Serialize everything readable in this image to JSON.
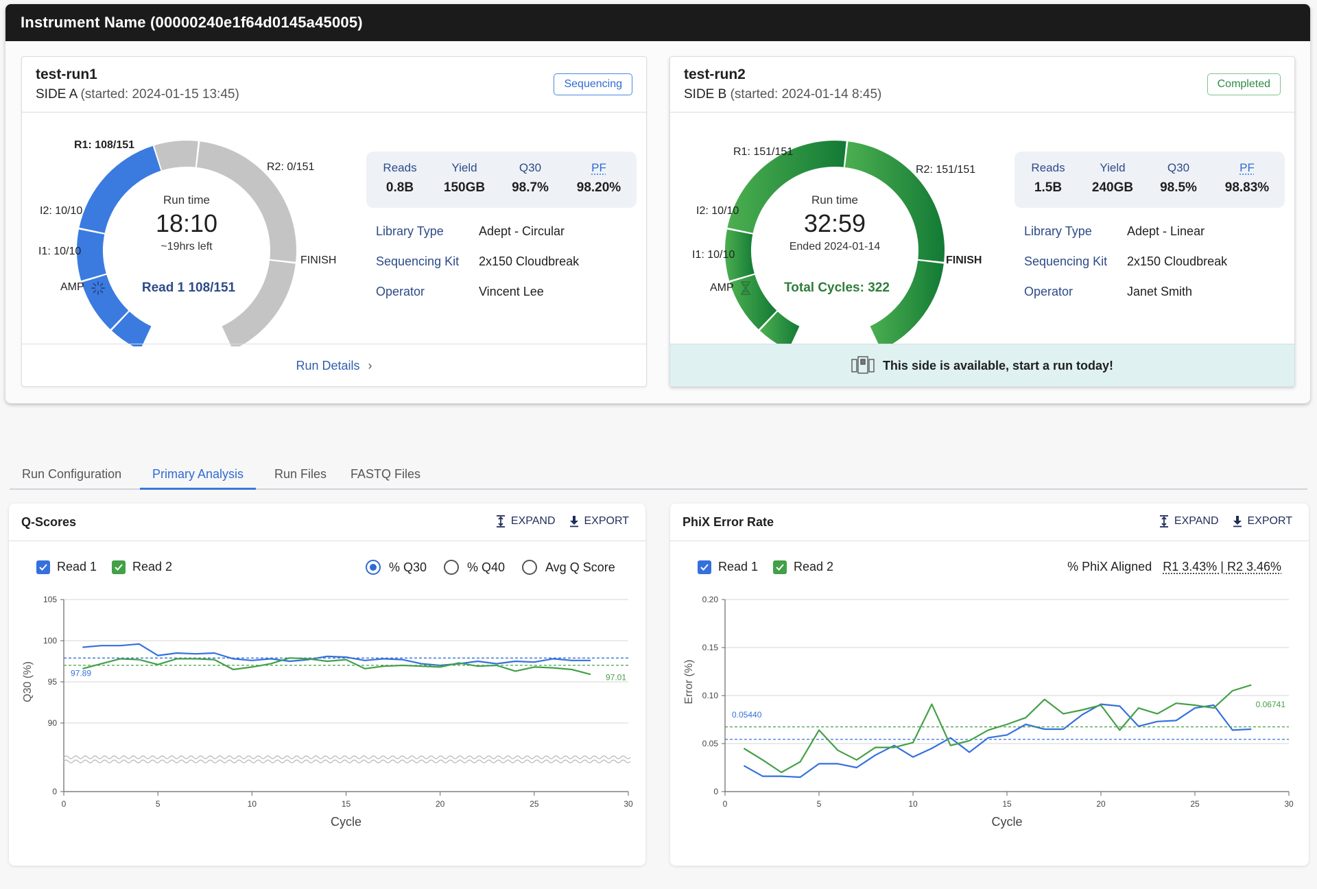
{
  "instrument": {
    "title": "Instrument Name (00000240e1f64d0145a45005)"
  },
  "runs": [
    {
      "name": "test-run1",
      "side": "SIDE A",
      "started": "(started: 2024-01-15 13:45)",
      "status": "Sequencing",
      "gauge": {
        "segments": [
          {
            "key": "AMP",
            "label": "AMP",
            "complete": true
          },
          {
            "key": "I1",
            "label": "I1: 10/10",
            "done": 10,
            "total": 10
          },
          {
            "key": "I2",
            "label": "I2: 10/10",
            "done": 10,
            "total": 10
          },
          {
            "key": "R1",
            "label": "R1: 108/151",
            "done": 108,
            "total": 151
          },
          {
            "key": "R2",
            "label": "R2: 0/151",
            "done": 0,
            "total": 151
          },
          {
            "key": "FINISH",
            "label": "FINISH",
            "complete": false
          }
        ],
        "run_time_label": "Run time",
        "run_time": "18:10",
        "sub": "~19hrs left",
        "status_text": "Read 1 108/151",
        "status_icon": "spinner-icon"
      },
      "stats": [
        {
          "label": "Reads",
          "value": "0.8B"
        },
        {
          "label": "Yield",
          "value": "150GB"
        },
        {
          "label": "Q30",
          "value": "98.7%"
        },
        {
          "label": "PF",
          "value": "98.20%"
        }
      ],
      "meta": [
        {
          "label": "Library Type",
          "value": "Adept - Circular"
        },
        {
          "label": "Sequencing Kit",
          "value": "2x150 Cloudbreak"
        },
        {
          "label": "Operator",
          "value": "Vincent Lee"
        }
      ],
      "footer": "Run Details",
      "footer_icon": "chevron-right-icon"
    },
    {
      "name": "test-run2",
      "side": "SIDE B",
      "started": "(started: 2024-01-14 8:45)",
      "status": "Completed",
      "gauge": {
        "segments": [
          {
            "key": "AMP",
            "label": "AMP",
            "complete": true
          },
          {
            "key": "I1",
            "label": "I1: 10/10",
            "done": 10,
            "total": 10
          },
          {
            "key": "I2",
            "label": "I2: 10/10",
            "done": 10,
            "total": 10
          },
          {
            "key": "R1",
            "label": "R1: 151/151",
            "done": 151,
            "total": 151
          },
          {
            "key": "R2",
            "label": "R2: 151/151",
            "done": 151,
            "total": 151
          },
          {
            "key": "FINISH",
            "label": "FINISH",
            "complete": true
          }
        ],
        "run_time_label": "Run time",
        "run_time": "32:59",
        "sub": "Ended 2024-01-14",
        "status_text": "Total Cycles: 322",
        "status_icon": "dna-icon"
      },
      "stats": [
        {
          "label": "Reads",
          "value": "1.5B"
        },
        {
          "label": "Yield",
          "value": "240GB"
        },
        {
          "label": "Q30",
          "value": "98.5%"
        },
        {
          "label": "PF",
          "value": "98.83%"
        }
      ],
      "meta": [
        {
          "label": "Library Type",
          "value": "Adept - Linear"
        },
        {
          "label": "Sequencing Kit",
          "value": "2x150 Cloudbreak"
        },
        {
          "label": "Operator",
          "value": "Janet Smith"
        }
      ],
      "footer": "This side is available, start a run today!",
      "footer_icon": "instrument-icon"
    }
  ],
  "tabs": [
    {
      "label": "Run Configuration",
      "active": false
    },
    {
      "label": "Primary Analysis",
      "active": true
    },
    {
      "label": "Run Files",
      "active": false
    },
    {
      "label": "FASTQ Files",
      "active": false
    }
  ],
  "panels": {
    "expand_label": "EXPAND",
    "export_label": "EXPORT",
    "qscores": {
      "title": "Q-Scores",
      "read1_label": "Read 1",
      "read2_label": "Read 2",
      "radios": [
        {
          "label": "% Q30",
          "selected": true
        },
        {
          "label": "% Q40",
          "selected": false
        },
        {
          "label": "Avg Q Score",
          "selected": false
        }
      ]
    },
    "phix": {
      "title": "PhiX Error Rate",
      "read1_label": "Read 1",
      "read2_label": "Read 2",
      "aligned_label": "% PhiX Aligned",
      "aligned_values": "R1 3.43% | R2 3.46%"
    }
  },
  "colors": {
    "read1": "#3570dd",
    "read2": "#43a047",
    "gauge_active": "#3b7be0",
    "gauge_pending": "#c4c4c4",
    "gauge_done_light": "#4caf50",
    "gauge_done_dark": "#137a35"
  },
  "chart_data": [
    {
      "type": "line",
      "title": "Q-Scores",
      "xlabel": "Cycle",
      "ylabel": "Q30 (%)",
      "xlim": [
        0,
        30
      ],
      "ylim_broken": [
        0,
        88,
        105
      ],
      "xticks": [
        0,
        5,
        10,
        15,
        20,
        25,
        30
      ],
      "yticks": [
        0,
        90,
        95,
        100,
        105
      ],
      "grid": true,
      "x": [
        1,
        2,
        3,
        4,
        5,
        6,
        7,
        8,
        9,
        10,
        11,
        12,
        13,
        14,
        15,
        16,
        17,
        18,
        19,
        20,
        21,
        22,
        23,
        24,
        25,
        26,
        27,
        28
      ],
      "series": [
        {
          "name": "Read 1",
          "values": [
            99.2,
            99.4,
            99.4,
            99.6,
            98.2,
            98.5,
            98.4,
            98.5,
            97.8,
            97.6,
            97.8,
            97.5,
            97.7,
            98.1,
            98.0,
            97.6,
            97.8,
            97.7,
            97.2,
            97.0,
            97.2,
            97.5,
            97.2,
            97.5,
            97.4,
            97.8,
            97.6,
            97.6
          ],
          "mean": 97.89,
          "mean_label": "97.89"
        },
        {
          "name": "Read 2",
          "values": [
            96.6,
            97.2,
            97.8,
            97.7,
            97.1,
            97.8,
            97.8,
            97.7,
            96.5,
            96.8,
            97.2,
            97.9,
            97.8,
            97.5,
            97.7,
            96.6,
            96.9,
            97.0,
            96.9,
            96.8,
            97.3,
            96.9,
            97.0,
            96.3,
            96.8,
            96.7,
            96.5,
            95.9
          ],
          "mean": 97.01,
          "mean_label": "97.01"
        }
      ]
    },
    {
      "type": "line",
      "title": "PhiX Error Rate",
      "xlabel": "Cycle",
      "ylabel": "Error (%)",
      "xlim": [
        0,
        30
      ],
      "ylim": [
        0,
        0.2
      ],
      "xticks": [
        0,
        5,
        10,
        15,
        20,
        25,
        30
      ],
      "yticks": [
        "0",
        "0.05",
        "0.10",
        "0.15",
        "0.20"
      ],
      "grid": true,
      "x": [
        1,
        2,
        3,
        4,
        5,
        6,
        7,
        8,
        9,
        10,
        11,
        12,
        13,
        14,
        15,
        16,
        17,
        18,
        19,
        20,
        21,
        22,
        23,
        24,
        25,
        26,
        27,
        28
      ],
      "series": [
        {
          "name": "Read 1",
          "values": [
            0.027,
            0.016,
            0.016,
            0.015,
            0.029,
            0.029,
            0.025,
            0.038,
            0.048,
            0.036,
            0.045,
            0.056,
            0.041,
            0.056,
            0.059,
            0.07,
            0.065,
            0.065,
            0.08,
            0.091,
            0.089,
            0.068,
            0.073,
            0.074,
            0.087,
            0.09,
            0.064,
            0.065
          ],
          "mean": 0.0544,
          "mean_label": "0.05440"
        },
        {
          "name": "Read 2",
          "values": [
            0.045,
            0.033,
            0.02,
            0.031,
            0.064,
            0.043,
            0.033,
            0.046,
            0.046,
            0.051,
            0.091,
            0.048,
            0.053,
            0.064,
            0.07,
            0.077,
            0.096,
            0.081,
            0.085,
            0.09,
            0.064,
            0.087,
            0.081,
            0.092,
            0.09,
            0.087,
            0.105,
            0.111
          ],
          "mean": 0.06741,
          "mean_label": "0.06741"
        }
      ]
    }
  ]
}
